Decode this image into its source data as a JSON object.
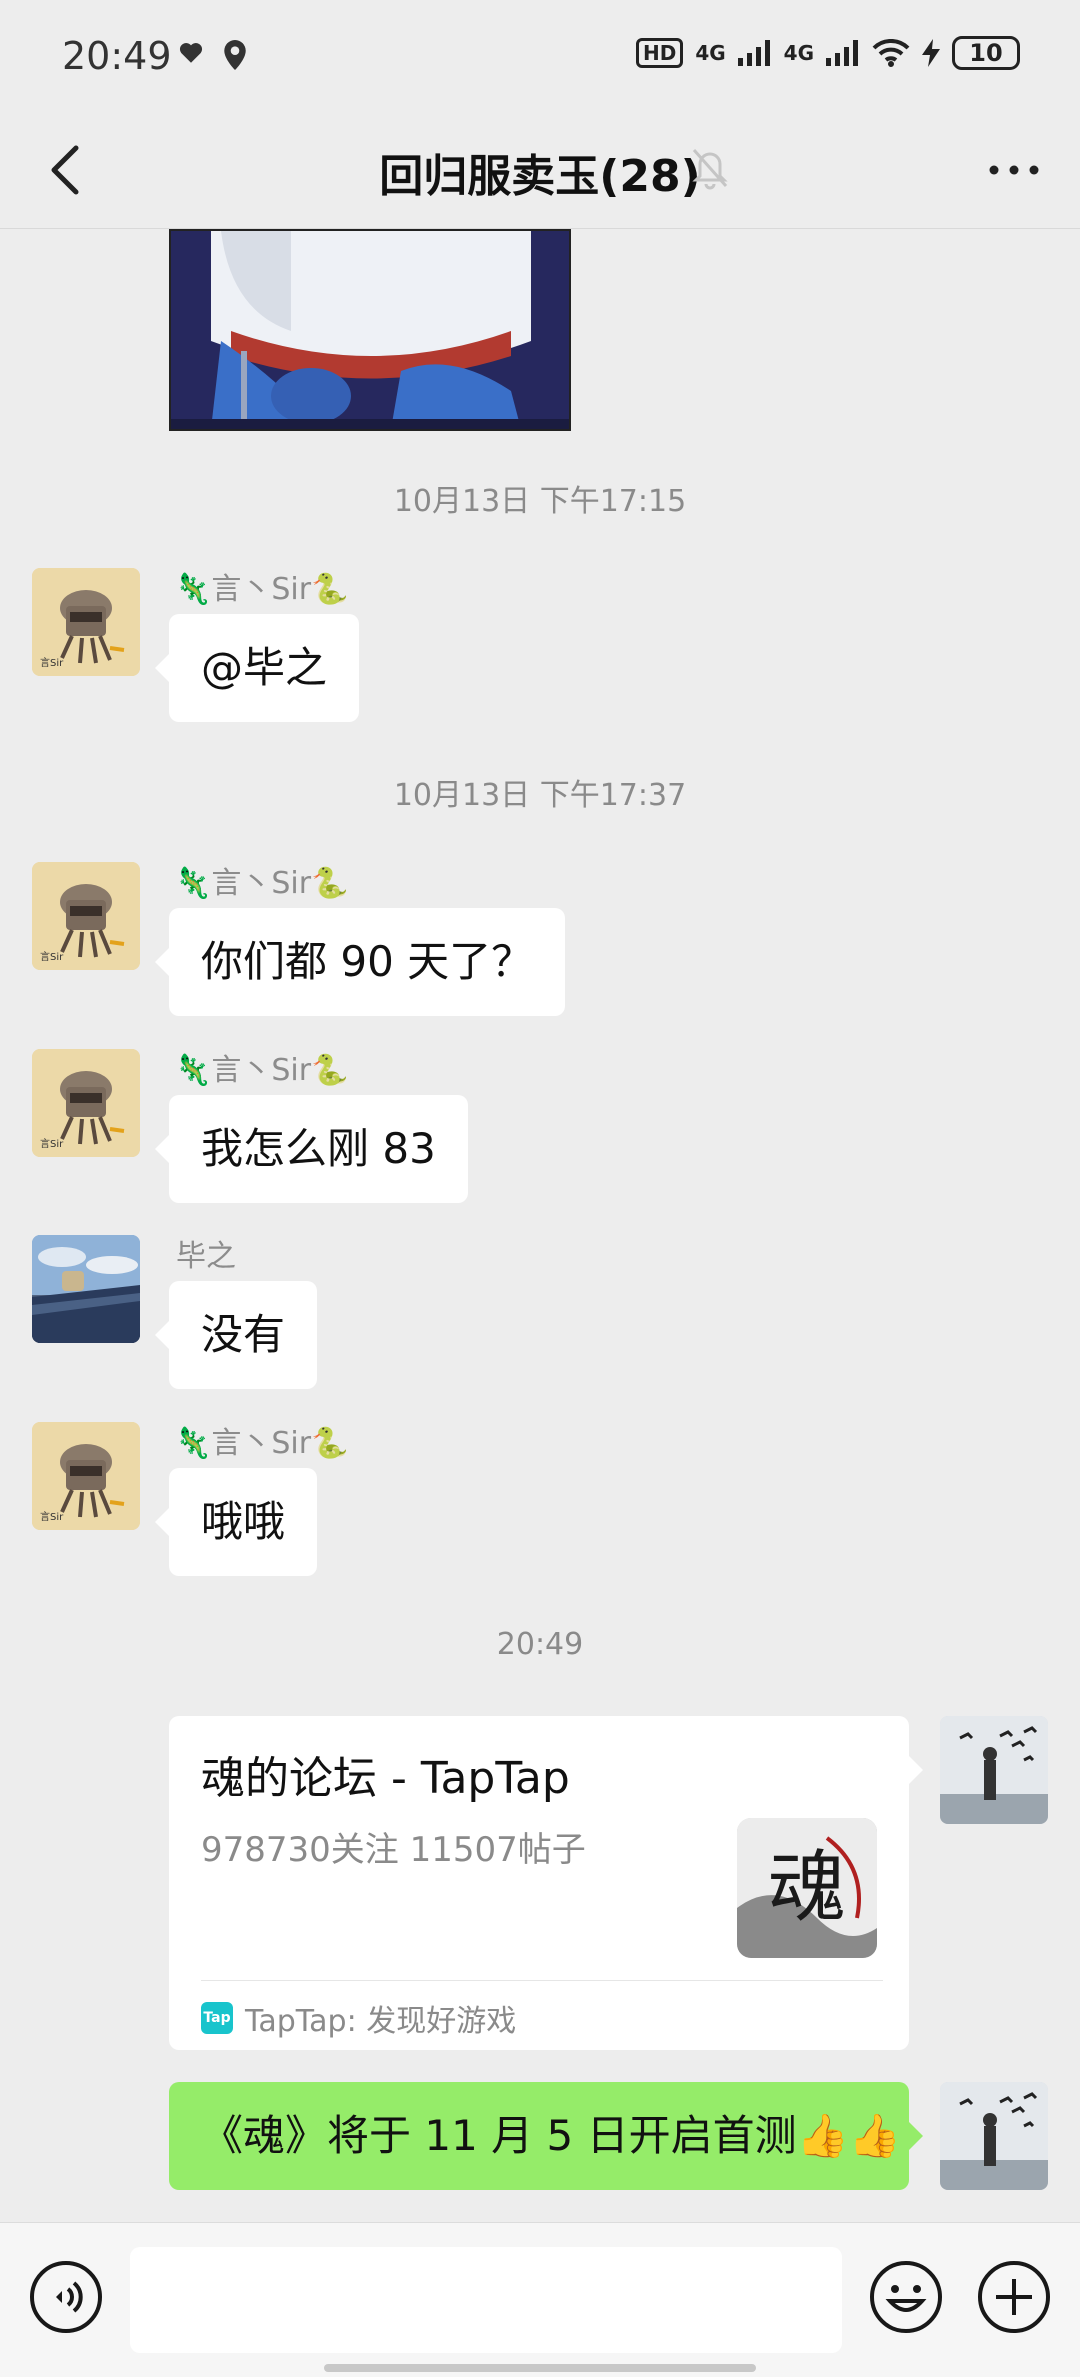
{
  "status_bar": {
    "time": "20:49",
    "hd": "HD",
    "network1": "4G",
    "network2": "4G",
    "battery": "10"
  },
  "header": {
    "title": "回归服卖玉(28)"
  },
  "messages": {
    "ts1": "10月13日 下午17:15",
    "ts2": "10月13日 下午17:37",
    "ts3": "20:49",
    "name_yan": "言丶Sir",
    "name_bizhi": "毕之",
    "m1": "@毕之",
    "m2": "你们都 90 天了？",
    "m3": "我怎么刚 83",
    "m4": "没有",
    "m5": "哦哦",
    "share_title": "魂的论坛 - TapTap",
    "share_desc": "978730关注 11507帖子",
    "share_source": "TapTap: 发现好游戏",
    "share_source_logo": "Tap",
    "thumb_text": "魂",
    "m6": "《魂》将于 11 月 5 日开启首测",
    "m6_emoji": "👍👍"
  },
  "input": {
    "value": ""
  },
  "icons": {
    "back": "chevron-left-icon",
    "mute": "bell-off-icon",
    "more": "more-horizontal-icon",
    "voice": "voice-icon",
    "emoji": "emoji-icon",
    "add": "plus-icon"
  }
}
